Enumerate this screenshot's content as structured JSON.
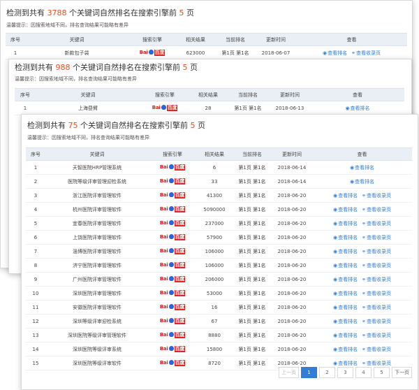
{
  "panel1": {
    "title_prefix": "检测到共有",
    "count": "3788",
    "title_mid": "个关键词自然排名在搜索引擎前",
    "top": "5",
    "title_suffix": "页",
    "hint": "温馨提示：因搜索地域不同，排名查询结果可能略有差异",
    "headers": [
      "序号",
      "关键词",
      "搜索引擎",
      "相关结果",
      "当前排名",
      "更新时间",
      "查看"
    ],
    "rows": [
      {
        "no": "1",
        "keyword": "新款包子袋",
        "results": "623000",
        "rank": "第1页 第1名",
        "date": "2018-06-07",
        "actions": [
          "查看排名",
          "查看收录页"
        ]
      }
    ]
  },
  "panel2": {
    "title_prefix": "检测到共有",
    "count": "988",
    "title_mid": "个关键词自然排名在搜索引擎前",
    "top": "5",
    "title_suffix": "页",
    "hint": "温馨提示：因搜索地域不同，排名查询结果可能略有差异",
    "headers": [
      "序号",
      "关键词",
      "搜索引擎",
      "相关结果",
      "当前排名",
      "更新时间",
      "查看"
    ],
    "rows": [
      {
        "no": "1",
        "keyword": "上海昼臂",
        "results": "28",
        "rank": "第1页 第1名",
        "date": "2018-06-13",
        "actions": [
          "查看排名"
        ]
      }
    ]
  },
  "panel3": {
    "title_prefix": "检测到共有",
    "count": "75",
    "title_mid": "个关键词自然排名在搜索引擎前",
    "top": "5",
    "title_suffix": "页",
    "hint": "温馨提示：因搜索地域不同，排名查询结果可能略有差异",
    "headers": [
      "序号",
      "关键词",
      "搜索引擎",
      "相关结果",
      "当前排名",
      "更新时间",
      "查看"
    ],
    "rows": [
      {
        "no": "1",
        "keyword": "天智医院HRP管理系统",
        "results": "6",
        "rank": "第1页 第1名",
        "date": "2018-06-14",
        "actions": [
          "查看排名"
        ]
      },
      {
        "no": "2",
        "keyword": "医院等级评审管理迎检系统",
        "results": "33",
        "rank": "第1页 第1名",
        "date": "2018-06-14",
        "actions": [
          "查看排名"
        ]
      },
      {
        "no": "3",
        "keyword": "浙江医院评审管理软件",
        "results": "41300",
        "rank": "第1页 第1名",
        "date": "2018-06-20",
        "actions": [
          "查看排名",
          "查看收录页"
        ]
      },
      {
        "no": "4",
        "keyword": "杭州医院评审管理软件",
        "results": "5090000",
        "rank": "第1页 第1名",
        "date": "2018-06-20",
        "actions": [
          "查看排名",
          "查看收录页"
        ]
      },
      {
        "no": "5",
        "keyword": "宜春医院评审管理软件",
        "results": "237000",
        "rank": "第1页 第1名",
        "date": "2018-06-20",
        "actions": [
          "查看排名",
          "查看收录页"
        ]
      },
      {
        "no": "6",
        "keyword": "上饶医院评审管理软件",
        "results": "57900",
        "rank": "第1页 第1名",
        "date": "2018-06-20",
        "actions": [
          "查看排名",
          "查看收录页"
        ]
      },
      {
        "no": "7",
        "keyword": "淄博医院评审管理软件",
        "results": "106000",
        "rank": "第1页 第1名",
        "date": "2018-06-20",
        "actions": [
          "查看排名",
          "查看收录页"
        ]
      },
      {
        "no": "8",
        "keyword": "济宁医院评审管理软件",
        "results": "106000",
        "rank": "第1页 第1名",
        "date": "2018-06-20",
        "actions": [
          "查看排名",
          "查看收录页"
        ]
      },
      {
        "no": "9",
        "keyword": "广州医院评审管理软件",
        "results": "206000",
        "rank": "第1页 第1名",
        "date": "2018-06-20",
        "actions": [
          "查看排名",
          "查看收录页"
        ]
      },
      {
        "no": "10",
        "keyword": "深圳医院评审管理软件",
        "results": "53000",
        "rank": "第1页 第1名",
        "date": "2018-06-20",
        "actions": [
          "查看排名",
          "查看收录页"
        ]
      },
      {
        "no": "11",
        "keyword": "安徽医院评审管理软件",
        "results": "16",
        "rank": "第1页 第1名",
        "date": "2018-06-20",
        "actions": [
          "查看排名",
          "查看收录页"
        ]
      },
      {
        "no": "12",
        "keyword": "深圳等级评审迎检系统",
        "results": "67",
        "rank": "第1页 第1名",
        "date": "2018-06-20",
        "actions": [
          "查看排名",
          "查看收录页"
        ]
      },
      {
        "no": "13",
        "keyword": "深圳医院等级评审管理软件",
        "results": "8880",
        "rank": "第1页 第1名",
        "date": "2018-06-20",
        "actions": [
          "查看排名",
          "查看收录页"
        ]
      },
      {
        "no": "14",
        "keyword": "深圳医院等级评审系统",
        "results": "15800",
        "rank": "第1页 第1名",
        "date": "2018-06-20",
        "actions": [
          "查看排名",
          "查看收录页"
        ]
      },
      {
        "no": "15",
        "keyword": "深圳医院等级评审软件",
        "results": "8720",
        "rank": "第1页 第1名",
        "date": "2018-06-20",
        "actions": [
          "查看排名",
          "查看收录页"
        ]
      }
    ],
    "pagination": {
      "prev": "上一页",
      "pages": [
        "1",
        "2",
        "3",
        "4",
        "5"
      ],
      "active": "1",
      "next": "下一页"
    }
  },
  "engine": {
    "name": "Baidu",
    "logo_left": "Bai",
    "logo_right": "百度"
  },
  "icons": {
    "view": "eye-icon",
    "link": "link-icon"
  },
  "colors": {
    "accent": "#2f7fd8",
    "highlight": "#e8501f",
    "header_bg": "#eaeff6",
    "baidu_red": "#e02020",
    "baidu_blue": "#2d62d8"
  }
}
